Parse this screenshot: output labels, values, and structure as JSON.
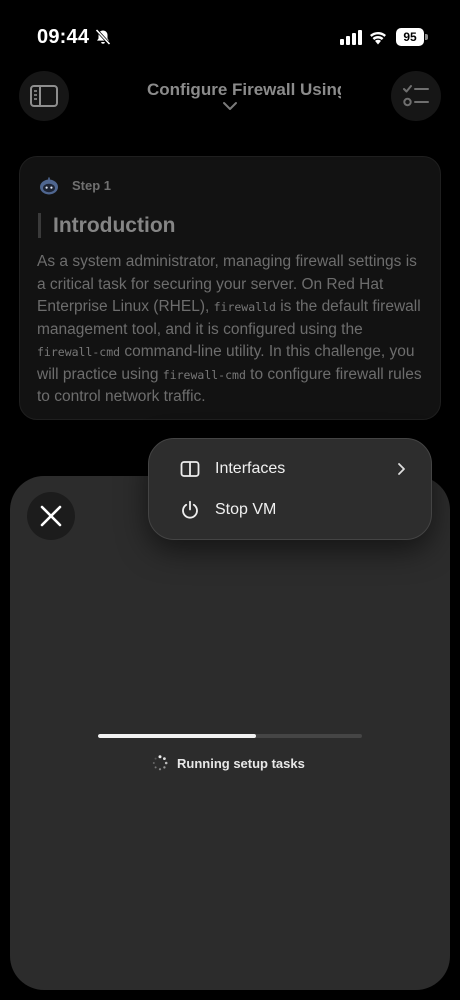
{
  "status_bar": {
    "time": "09:44",
    "battery": "95"
  },
  "header": {
    "title": "Configure Firewall Using"
  },
  "step": {
    "label": "Step 1",
    "heading": "Introduction",
    "body": {
      "t1": "As a system administrator, managing firewall settings is a critical task for securing your server. On Red Hat Enterprise Linux (RHEL), ",
      "c1": "firewalld",
      "t2": " is the default firewall management tool, and it is configured using the ",
      "c2": "firewall-cmd",
      "t3": " command-line utility. In this challenge, you will practice using ",
      "c3": "firewall-cmd",
      "t4": " to configure firewall rules to control network traffic."
    }
  },
  "menu": {
    "items": [
      {
        "label": "Interfaces"
      },
      {
        "label": "Stop VM"
      }
    ]
  },
  "setup": {
    "status": "Running setup tasks",
    "progress_fraction": 0.6
  },
  "colors": {
    "background": "#000000",
    "card": "#121212",
    "sheet": "#2c2c2c",
    "menu": "#2d2d2d",
    "progress": "#f2f2f2"
  }
}
